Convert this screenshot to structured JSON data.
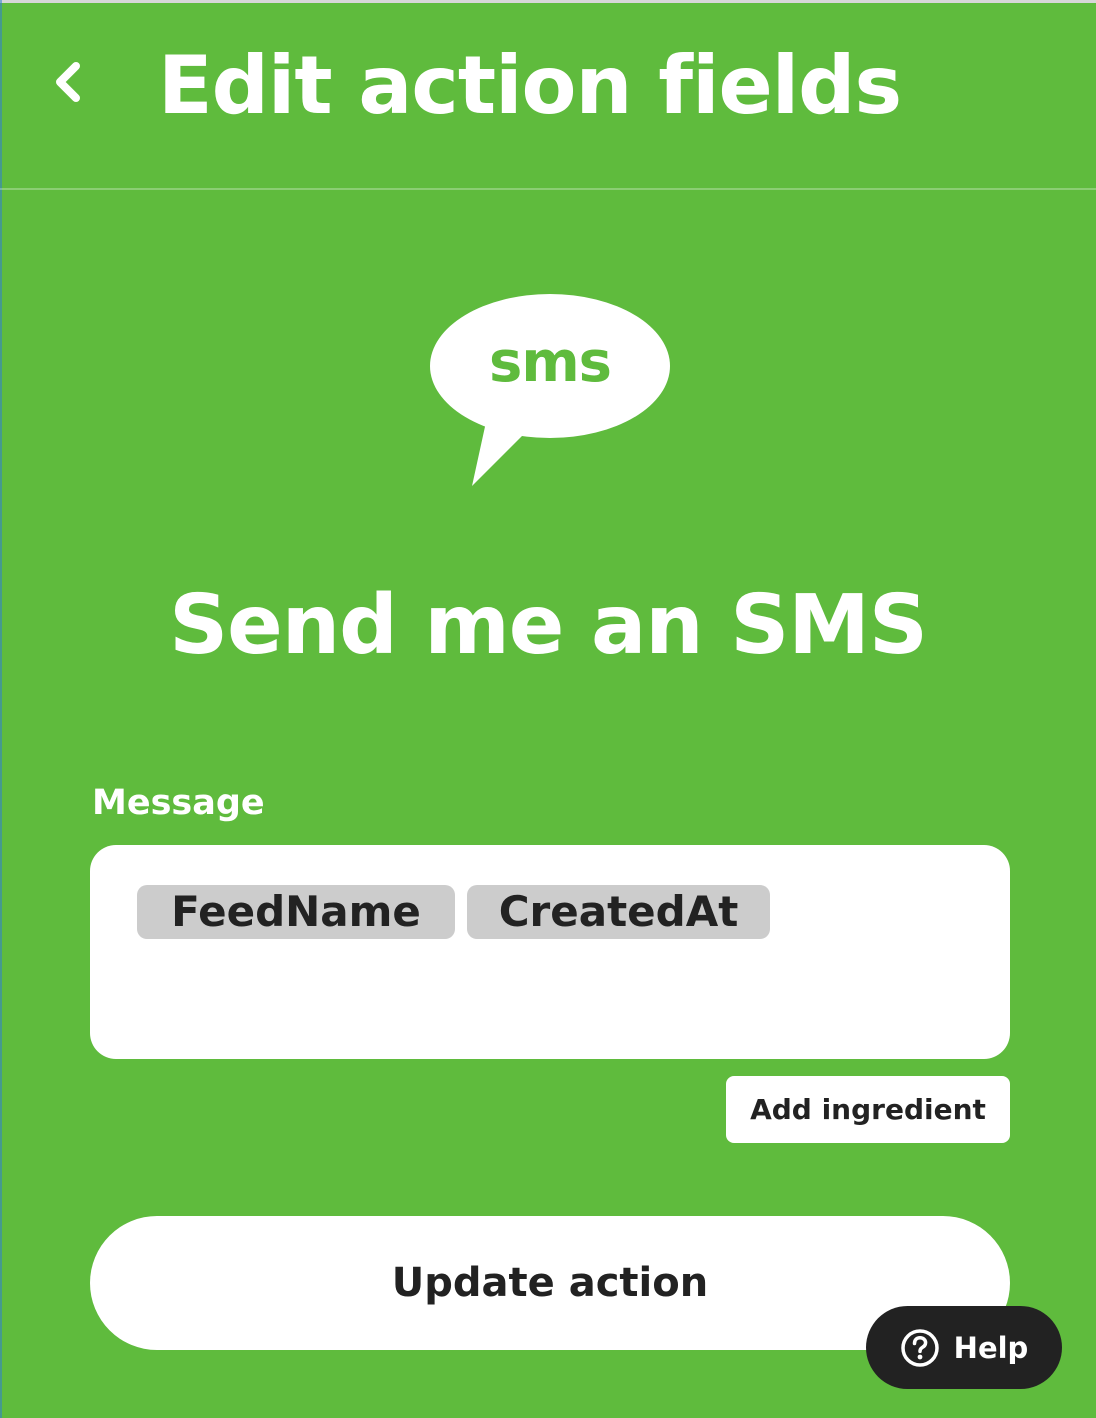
{
  "header": {
    "title": "Edit action fields",
    "back_icon": "chevron-left-icon"
  },
  "service": {
    "logo_text": "sms",
    "logo_icon": "speech-bubble-icon"
  },
  "action": {
    "title": "Send me an SMS"
  },
  "message_field": {
    "label": "Message",
    "ingredients": [
      "FeedName",
      "CreatedAt"
    ]
  },
  "buttons": {
    "add_ingredient": "Add ingredient",
    "update_action": "Update action",
    "help": "Help"
  },
  "colors": {
    "brand_green": "#5fbb3d",
    "white": "#ffffff",
    "pill_gray": "#cccccc",
    "dark": "#222222"
  }
}
